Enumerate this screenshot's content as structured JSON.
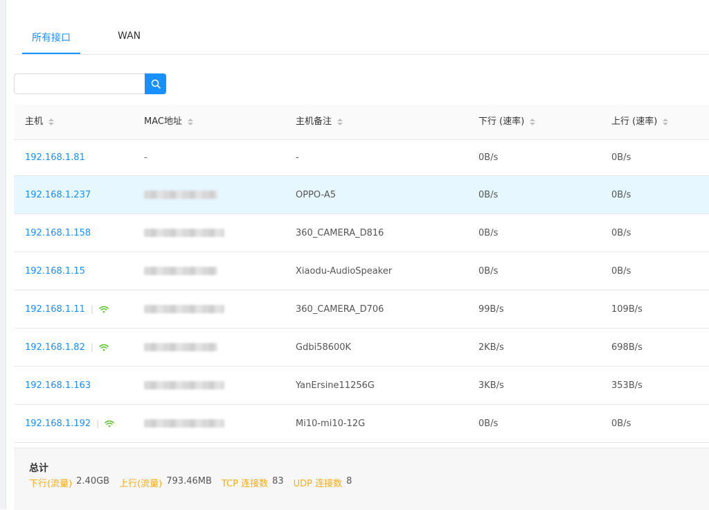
{
  "tabs": [
    {
      "label": "所有接口",
      "active": true
    },
    {
      "label": "WAN",
      "active": false
    }
  ],
  "search": {
    "value": "",
    "placeholder": ""
  },
  "table": {
    "headers": [
      "主机",
      "MAC地址",
      "主机备注",
      "下行 (速率)",
      "上行 (速率)"
    ],
    "rows": [
      {
        "host": "192.168.1.81",
        "wifi": false,
        "mac": "-",
        "note": "-",
        "down": "0B/s",
        "up": "0B/s"
      },
      {
        "host": "192.168.1.237",
        "wifi": false,
        "mac": "",
        "note": "OPPO-A5",
        "down": "0B/s",
        "up": "0B/s"
      },
      {
        "host": "192.168.1.158",
        "wifi": false,
        "mac": "",
        "note": "360_CAMERA_D816",
        "down": "0B/s",
        "up": "0B/s"
      },
      {
        "host": "192.168.1.15",
        "wifi": false,
        "mac": "",
        "note": "Xiaodu-AudioSpeaker",
        "down": "0B/s",
        "up": "0B/s"
      },
      {
        "host": "192.168.1.11",
        "wifi": true,
        "mac": "",
        "note": "360_CAMERA_D706",
        "down": "99B/s",
        "up": "109B/s"
      },
      {
        "host": "192.168.1.82",
        "wifi": true,
        "mac": "",
        "note": "Gdbi58600K",
        "down": "2KB/s",
        "up": "698B/s"
      },
      {
        "host": "192.168.1.163",
        "wifi": false,
        "mac": "",
        "note": "YanErsine11256G",
        "down": "3KB/s",
        "up": "353B/s"
      },
      {
        "host": "192.168.1.192",
        "wifi": true,
        "mac": "",
        "note": "Mi10-mi10-12G",
        "down": "0B/s",
        "up": "0B/s"
      }
    ]
  },
  "summary": {
    "title": "总计",
    "down_label": "下行(流量)",
    "down_value": "2.40GB",
    "up_label": "上行(流量)",
    "up_value": "793.46MB",
    "tcp_label": "TCP 连接数",
    "tcp_value": "83",
    "udp_label": "UDP 连接数",
    "udp_value": "8"
  },
  "colors": {
    "accent": "#1890ff",
    "wifi": "#52c41a",
    "summary_label": "#faad14"
  },
  "icons": {
    "search": "search-icon",
    "wifi": "wifi-icon",
    "sort": "sort-icon"
  }
}
